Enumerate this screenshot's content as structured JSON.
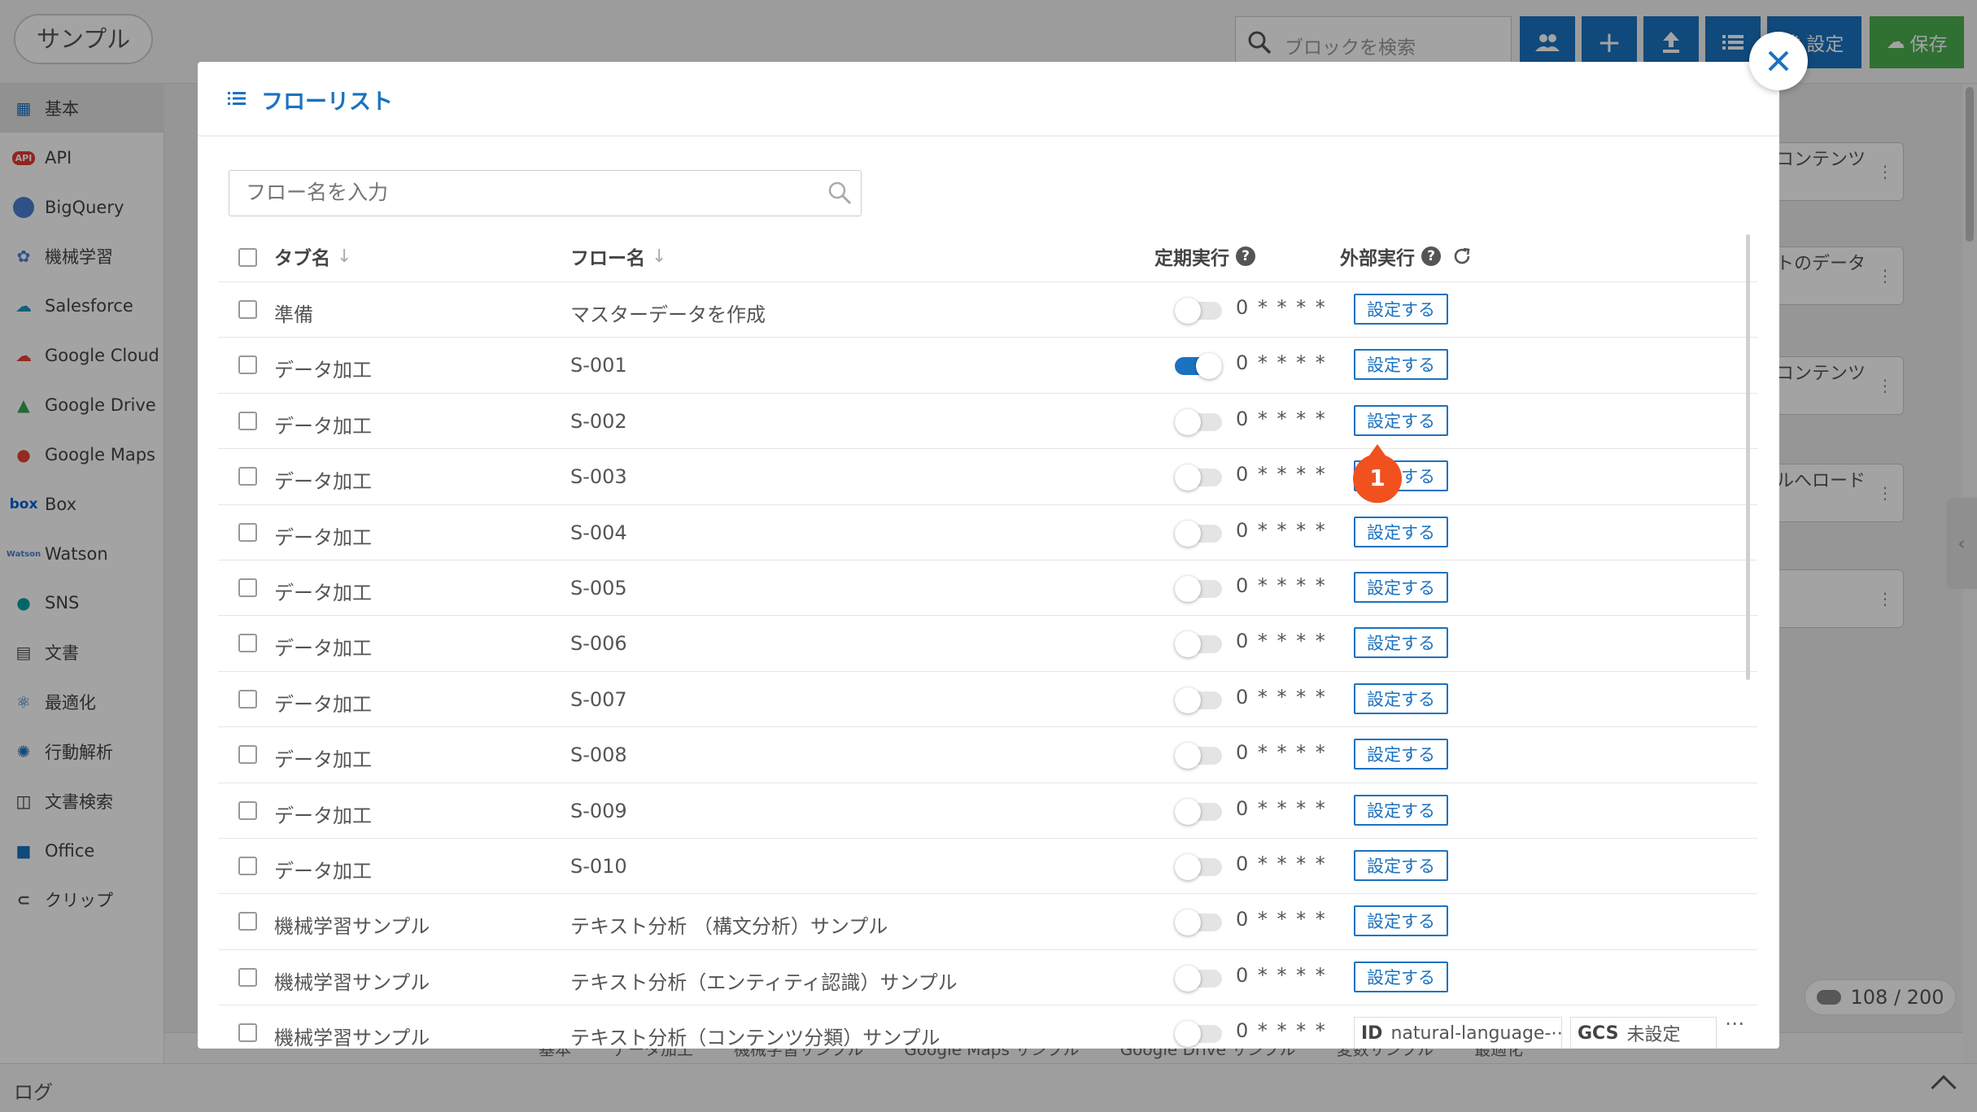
{
  "app": {
    "title": "サンプル",
    "search_placeholder": "ブロックを検索",
    "settings_label": "設定",
    "save_label": "保存"
  },
  "sidebar": {
    "items": [
      {
        "label": "基本",
        "icon": "basic-icon"
      },
      {
        "label": "API",
        "icon": "api-icon"
      },
      {
        "label": "BigQuery",
        "icon": "bigquery-icon"
      },
      {
        "label": "機械学習",
        "icon": "machine-learning-icon"
      },
      {
        "label": "Salesforce",
        "icon": "salesforce-icon"
      },
      {
        "label": "Google Cloud",
        "icon": "google-cloud-icon"
      },
      {
        "label": "Google Drive",
        "icon": "google-drive-icon"
      },
      {
        "label": "Google Maps",
        "icon": "google-maps-icon"
      },
      {
        "label": "Box",
        "icon": "box-icon"
      },
      {
        "label": "Watson",
        "icon": "watson-icon"
      },
      {
        "label": "SNS",
        "icon": "sns-icon"
      },
      {
        "label": "文書",
        "icon": "document-icon"
      },
      {
        "label": "最適化",
        "icon": "optimization-icon"
      },
      {
        "label": "行動解析",
        "icon": "behavior-analysis-icon"
      },
      {
        "label": "文書検索",
        "icon": "document-search-icon"
      },
      {
        "label": "Office",
        "icon": "office-icon"
      },
      {
        "label": "クリップ",
        "icon": "clip-icon"
      }
    ]
  },
  "background_cards": [
    "（コンテンツ\nル",
    "ートのデータ",
    "（コンテンツ",
    "ブルへロード",
    ""
  ],
  "counter": "108 / 200",
  "bottom_tabs": [
    "基本",
    "データ加工",
    "機械学習サンプル",
    "Google Maps サンプル",
    "Google Drive サンプル",
    "変数サンプル",
    "最適化"
  ],
  "log_label": "ログ",
  "modal": {
    "title": "フローリスト",
    "search_placeholder": "フロー名を入力",
    "columns": {
      "tag": "タブ名",
      "flow": "フロー名",
      "schedule": "定期実行",
      "external": "外部実行"
    },
    "set_label": "設定する",
    "marker_number": "1",
    "rows": [
      {
        "tag": "準備",
        "flow": "マスターデータを作成",
        "on": false,
        "cron": "0 * * * *"
      },
      {
        "tag": "データ加工",
        "flow": "S-001",
        "on": true,
        "cron": "0 * * * *"
      },
      {
        "tag": "データ加工",
        "flow": "S-002",
        "on": false,
        "cron": "0 * * * *"
      },
      {
        "tag": "データ加工",
        "flow": "S-003",
        "on": false,
        "cron": "0 * * * *"
      },
      {
        "tag": "データ加工",
        "flow": "S-004",
        "on": false,
        "cron": "0 * * * *"
      },
      {
        "tag": "データ加工",
        "flow": "S-005",
        "on": false,
        "cron": "0 * * * *"
      },
      {
        "tag": "データ加工",
        "flow": "S-006",
        "on": false,
        "cron": "0 * * * *"
      },
      {
        "tag": "データ加工",
        "flow": "S-007",
        "on": false,
        "cron": "0 * * * *"
      },
      {
        "tag": "データ加工",
        "flow": "S-008",
        "on": false,
        "cron": "0 * * * *"
      },
      {
        "tag": "データ加工",
        "flow": "S-009",
        "on": false,
        "cron": "0 * * * *"
      },
      {
        "tag": "データ加工",
        "flow": "S-010",
        "on": false,
        "cron": "0 * * * *"
      },
      {
        "tag": "機械学習サンプル",
        "flow": "テキスト分析 （構文分析）サンプル",
        "on": false,
        "cron": "0 * * * *"
      },
      {
        "tag": "機械学習サンプル",
        "flow": "テキスト分析（エンティティ認識）サンプル",
        "on": false,
        "cron": "0 * * * *"
      },
      {
        "tag": "機械学習サンプル",
        "flow": "テキスト分析（コンテンツ分類）サンプル",
        "on": false,
        "cron": "0 * * * *"
      }
    ],
    "last_row_external": {
      "id_label": "ID",
      "id_value": "natural-language-⋯",
      "gcs_label": "GCS",
      "gcs_value": "未設定",
      "more": "⋯"
    }
  }
}
